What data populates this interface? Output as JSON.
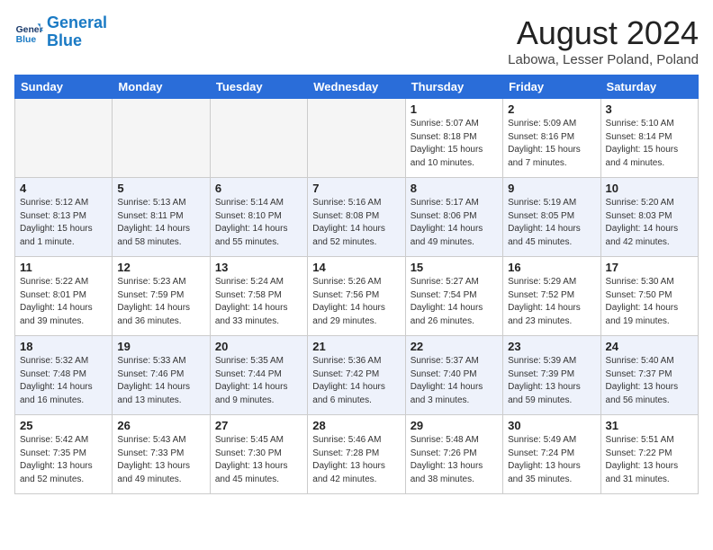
{
  "header": {
    "logo_line1": "General",
    "logo_line2": "Blue",
    "month_title": "August 2024",
    "location": "Labowa, Lesser Poland, Poland"
  },
  "days_of_week": [
    "Sunday",
    "Monday",
    "Tuesday",
    "Wednesday",
    "Thursday",
    "Friday",
    "Saturday"
  ],
  "weeks": [
    {
      "alt": false,
      "days": [
        {
          "num": "",
          "info": ""
        },
        {
          "num": "",
          "info": ""
        },
        {
          "num": "",
          "info": ""
        },
        {
          "num": "",
          "info": ""
        },
        {
          "num": "1",
          "info": "Sunrise: 5:07 AM\nSunset: 8:18 PM\nDaylight: 15 hours\nand 10 minutes."
        },
        {
          "num": "2",
          "info": "Sunrise: 5:09 AM\nSunset: 8:16 PM\nDaylight: 15 hours\nand 7 minutes."
        },
        {
          "num": "3",
          "info": "Sunrise: 5:10 AM\nSunset: 8:14 PM\nDaylight: 15 hours\nand 4 minutes."
        }
      ]
    },
    {
      "alt": true,
      "days": [
        {
          "num": "4",
          "info": "Sunrise: 5:12 AM\nSunset: 8:13 PM\nDaylight: 15 hours\nand 1 minute."
        },
        {
          "num": "5",
          "info": "Sunrise: 5:13 AM\nSunset: 8:11 PM\nDaylight: 14 hours\nand 58 minutes."
        },
        {
          "num": "6",
          "info": "Sunrise: 5:14 AM\nSunset: 8:10 PM\nDaylight: 14 hours\nand 55 minutes."
        },
        {
          "num": "7",
          "info": "Sunrise: 5:16 AM\nSunset: 8:08 PM\nDaylight: 14 hours\nand 52 minutes."
        },
        {
          "num": "8",
          "info": "Sunrise: 5:17 AM\nSunset: 8:06 PM\nDaylight: 14 hours\nand 49 minutes."
        },
        {
          "num": "9",
          "info": "Sunrise: 5:19 AM\nSunset: 8:05 PM\nDaylight: 14 hours\nand 45 minutes."
        },
        {
          "num": "10",
          "info": "Sunrise: 5:20 AM\nSunset: 8:03 PM\nDaylight: 14 hours\nand 42 minutes."
        }
      ]
    },
    {
      "alt": false,
      "days": [
        {
          "num": "11",
          "info": "Sunrise: 5:22 AM\nSunset: 8:01 PM\nDaylight: 14 hours\nand 39 minutes."
        },
        {
          "num": "12",
          "info": "Sunrise: 5:23 AM\nSunset: 7:59 PM\nDaylight: 14 hours\nand 36 minutes."
        },
        {
          "num": "13",
          "info": "Sunrise: 5:24 AM\nSunset: 7:58 PM\nDaylight: 14 hours\nand 33 minutes."
        },
        {
          "num": "14",
          "info": "Sunrise: 5:26 AM\nSunset: 7:56 PM\nDaylight: 14 hours\nand 29 minutes."
        },
        {
          "num": "15",
          "info": "Sunrise: 5:27 AM\nSunset: 7:54 PM\nDaylight: 14 hours\nand 26 minutes."
        },
        {
          "num": "16",
          "info": "Sunrise: 5:29 AM\nSunset: 7:52 PM\nDaylight: 14 hours\nand 23 minutes."
        },
        {
          "num": "17",
          "info": "Sunrise: 5:30 AM\nSunset: 7:50 PM\nDaylight: 14 hours\nand 19 minutes."
        }
      ]
    },
    {
      "alt": true,
      "days": [
        {
          "num": "18",
          "info": "Sunrise: 5:32 AM\nSunset: 7:48 PM\nDaylight: 14 hours\nand 16 minutes."
        },
        {
          "num": "19",
          "info": "Sunrise: 5:33 AM\nSunset: 7:46 PM\nDaylight: 14 hours\nand 13 minutes."
        },
        {
          "num": "20",
          "info": "Sunrise: 5:35 AM\nSunset: 7:44 PM\nDaylight: 14 hours\nand 9 minutes."
        },
        {
          "num": "21",
          "info": "Sunrise: 5:36 AM\nSunset: 7:42 PM\nDaylight: 14 hours\nand 6 minutes."
        },
        {
          "num": "22",
          "info": "Sunrise: 5:37 AM\nSunset: 7:40 PM\nDaylight: 14 hours\nand 3 minutes."
        },
        {
          "num": "23",
          "info": "Sunrise: 5:39 AM\nSunset: 7:39 PM\nDaylight: 13 hours\nand 59 minutes."
        },
        {
          "num": "24",
          "info": "Sunrise: 5:40 AM\nSunset: 7:37 PM\nDaylight: 13 hours\nand 56 minutes."
        }
      ]
    },
    {
      "alt": false,
      "days": [
        {
          "num": "25",
          "info": "Sunrise: 5:42 AM\nSunset: 7:35 PM\nDaylight: 13 hours\nand 52 minutes."
        },
        {
          "num": "26",
          "info": "Sunrise: 5:43 AM\nSunset: 7:33 PM\nDaylight: 13 hours\nand 49 minutes."
        },
        {
          "num": "27",
          "info": "Sunrise: 5:45 AM\nSunset: 7:30 PM\nDaylight: 13 hours\nand 45 minutes."
        },
        {
          "num": "28",
          "info": "Sunrise: 5:46 AM\nSunset: 7:28 PM\nDaylight: 13 hours\nand 42 minutes."
        },
        {
          "num": "29",
          "info": "Sunrise: 5:48 AM\nSunset: 7:26 PM\nDaylight: 13 hours\nand 38 minutes."
        },
        {
          "num": "30",
          "info": "Sunrise: 5:49 AM\nSunset: 7:24 PM\nDaylight: 13 hours\nand 35 minutes."
        },
        {
          "num": "31",
          "info": "Sunrise: 5:51 AM\nSunset: 7:22 PM\nDaylight: 13 hours\nand 31 minutes."
        }
      ]
    }
  ]
}
